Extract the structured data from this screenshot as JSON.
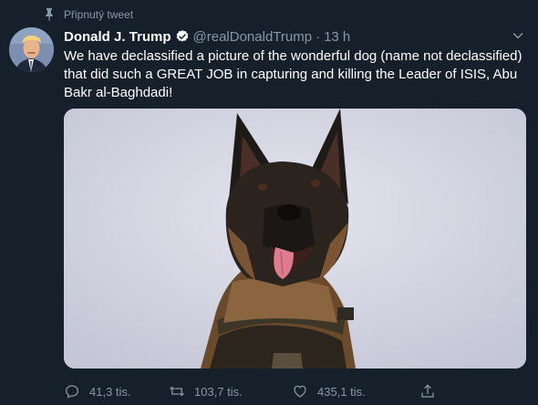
{
  "pinned": {
    "label": "Připnutý tweet",
    "icon": "pin-icon"
  },
  "tweet": {
    "author_name": "Donald J. Trump",
    "verified": true,
    "handle": "@realDonaldTrump",
    "separator": "·",
    "time": "13 h",
    "text": "We have declassified a picture of the wonderful dog (name not declassified) that did such a GREAT JOB in capturing and killing the Leader of ISIS, Abu Bakr al-Baghdadi!",
    "media": {
      "kind": "photo",
      "subject": "dog"
    }
  },
  "actions": {
    "replies": "41,3 tis.",
    "retweets": "103,7 tis.",
    "likes": "435,1 tis."
  },
  "colors": {
    "background": "#15202b",
    "secondary_text": "#8899a6",
    "verified_badge": "#1da1f2"
  }
}
